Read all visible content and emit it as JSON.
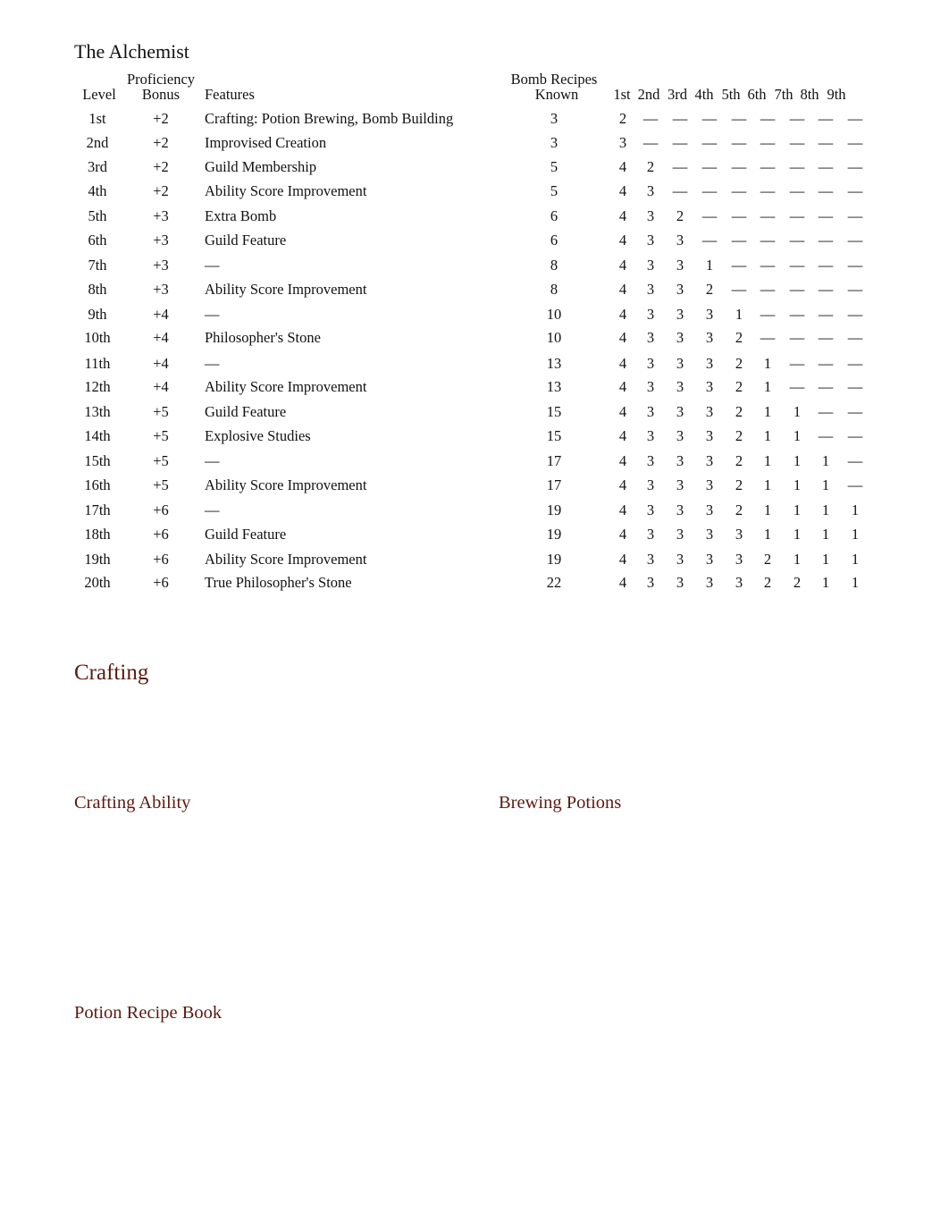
{
  "document": {
    "title": "The Alchemist",
    "table": {
      "headers": {
        "level": "Level",
        "proficiency_top": "Proficiency",
        "proficiency_bottom": "Bonus",
        "features": "Features",
        "bomb_top": "Bomb Recipes",
        "bomb_bottom": "Known",
        "slots": [
          "1st",
          "2nd",
          "3rd",
          "4th",
          "5th",
          "6th",
          "7th",
          "8th",
          "9th"
        ]
      },
      "rows": [
        {
          "level": "1st",
          "bonus": "+2",
          "features": "Crafting: Potion Brewing, Bomb Building",
          "bombs": "3",
          "slots": [
            "2",
            "—",
            "—",
            "—",
            "—",
            "—",
            "—",
            "—",
            "—"
          ]
        },
        {
          "level": "2nd",
          "bonus": "+2",
          "features": "Improvised Creation",
          "bombs": "3",
          "slots": [
            "3",
            "—",
            "—",
            "—",
            "—",
            "—",
            "—",
            "—",
            "—"
          ]
        },
        {
          "level": "3rd",
          "bonus": "+2",
          "features": "Guild Membership",
          "bombs": "5",
          "slots": [
            "4",
            "2",
            "—",
            "—",
            "—",
            "—",
            "—",
            "—",
            "—"
          ]
        },
        {
          "level": "4th",
          "bonus": "+2",
          "features": "Ability Score Improvement",
          "bombs": "5",
          "slots": [
            "4",
            "3",
            "—",
            "—",
            "—",
            "—",
            "—",
            "—",
            "—"
          ]
        },
        {
          "level": "5th",
          "bonus": "+3",
          "features": "Extra Bomb",
          "bombs": "6",
          "slots": [
            "4",
            "3",
            "2",
            "—",
            "—",
            "—",
            "—",
            "—",
            "—"
          ]
        },
        {
          "level": "6th",
          "bonus": "+3",
          "features": "Guild Feature",
          "bombs": "6",
          "slots": [
            "4",
            "3",
            "3",
            "—",
            "—",
            "—",
            "—",
            "—",
            "—"
          ]
        },
        {
          "level": "7th",
          "bonus": "+3",
          "features": "—",
          "bombs": "8",
          "slots": [
            "4",
            "3",
            "3",
            "1",
            "—",
            "—",
            "—",
            "—",
            "—"
          ]
        },
        {
          "level": "8th",
          "bonus": "+3",
          "features": "Ability Score Improvement",
          "bombs": "8",
          "slots": [
            "4",
            "3",
            "3",
            "2",
            "—",
            "—",
            "—",
            "—",
            "—"
          ]
        },
        {
          "level": "9th",
          "bonus": "+4",
          "features": "—",
          "bombs": "10",
          "slots": [
            "4",
            "3",
            "3",
            "3",
            "1",
            "—",
            "—",
            "—",
            "—"
          ]
        },
        {
          "level": "10th",
          "bonus": "+4",
          "features": "Philosopher's Stone",
          "bombs": "10",
          "slots": [
            "4",
            "3",
            "3",
            "3",
            "2",
            "—",
            "—",
            "—",
            "—"
          ]
        },
        {
          "level": "11th",
          "bonus": "+4",
          "features": "—",
          "bombs": "13",
          "slots": [
            "4",
            "3",
            "3",
            "3",
            "2",
            "1",
            "—",
            "—",
            "—"
          ]
        },
        {
          "level": "12th",
          "bonus": "+4",
          "features": "Ability Score Improvement",
          "bombs": "13",
          "slots": [
            "4",
            "3",
            "3",
            "3",
            "2",
            "1",
            "—",
            "—",
            "—"
          ]
        },
        {
          "level": "13th",
          "bonus": "+5",
          "features": "Guild Feature",
          "bombs": "15",
          "slots": [
            "4",
            "3",
            "3",
            "3",
            "2",
            "1",
            "1",
            "—",
            "—"
          ]
        },
        {
          "level": "14th",
          "bonus": "+5",
          "features": "Explosive Studies",
          "bombs": "15",
          "slots": [
            "4",
            "3",
            "3",
            "3",
            "2",
            "1",
            "1",
            "—",
            "—"
          ]
        },
        {
          "level": "15th",
          "bonus": "+5",
          "features": "—",
          "bombs": "17",
          "slots": [
            "4",
            "3",
            "3",
            "3",
            "2",
            "1",
            "1",
            "1",
            "—"
          ]
        },
        {
          "level": "16th",
          "bonus": "+5",
          "features": "Ability Score Improvement",
          "bombs": "17",
          "slots": [
            "4",
            "3",
            "3",
            "3",
            "2",
            "1",
            "1",
            "1",
            "—"
          ]
        },
        {
          "level": "17th",
          "bonus": "+6",
          "features": "—",
          "bombs": "19",
          "slots": [
            "4",
            "3",
            "3",
            "3",
            "2",
            "1",
            "1",
            "1",
            "1"
          ]
        },
        {
          "level": "18th",
          "bonus": "+6",
          "features": "Guild Feature",
          "bombs": "19",
          "slots": [
            "4",
            "3",
            "3",
            "3",
            "3",
            "1",
            "1",
            "1",
            "1"
          ]
        },
        {
          "level": "19th",
          "bonus": "+6",
          "features": "Ability Score Improvement",
          "bombs": "19",
          "slots": [
            "4",
            "3",
            "3",
            "3",
            "3",
            "2",
            "1",
            "1",
            "1"
          ]
        },
        {
          "level": "20th",
          "bonus": "+6",
          "features": "True Philosopher's Stone",
          "bombs": "22",
          "slots": [
            "4",
            "3",
            "3",
            "3",
            "3",
            "2",
            "2",
            "1",
            "1"
          ]
        }
      ]
    },
    "sections": {
      "crafting": "Crafting",
      "crafting_ability": "Crafting Ability",
      "brewing_potions": "Brewing Potions",
      "potion_recipe_book": "Potion Recipe Book"
    },
    "colors": {
      "section_heading": "#5a1a10",
      "text": "#111111"
    }
  }
}
